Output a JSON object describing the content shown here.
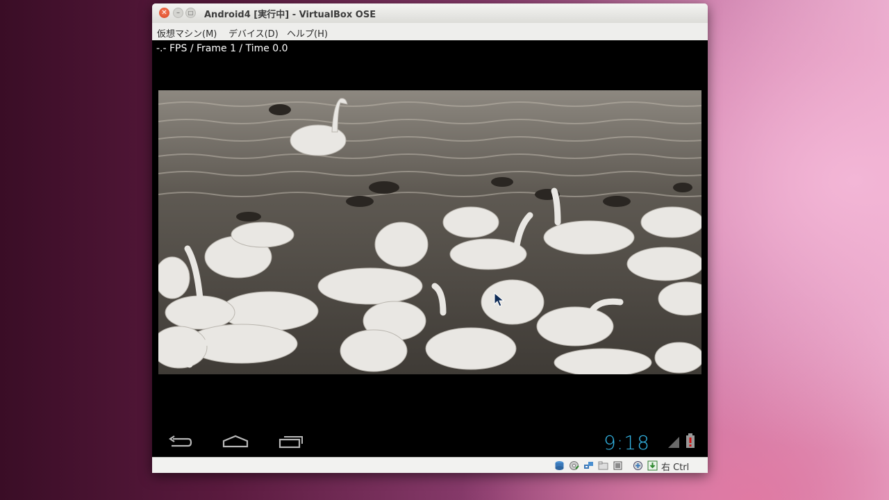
{
  "window": {
    "title": "Android4 [実行中] - VirtualBox OSE"
  },
  "menu": {
    "items": [
      "仮想マシン(M)",
      "デバイス(D)",
      "ヘルプ(H)"
    ]
  },
  "vm_screen": {
    "overlay_text": "-.- FPS /  Frame 1 / Time 0.0",
    "clock": "9:18",
    "nav_icons": [
      "back-icon",
      "home-icon",
      "recent-apps-icon"
    ],
    "status_icons": [
      "signal-icon",
      "battery-alert-icon"
    ],
    "accent_color": "#33b5e5"
  },
  "statusbar": {
    "icons": [
      "hard-disk-icon",
      "optical-drive-icon",
      "network-icon",
      "shared-folders-icon",
      "usb-icon",
      "virtualization-icon",
      "mouse-integration-icon"
    ],
    "host_key": "右 Ctrl"
  }
}
